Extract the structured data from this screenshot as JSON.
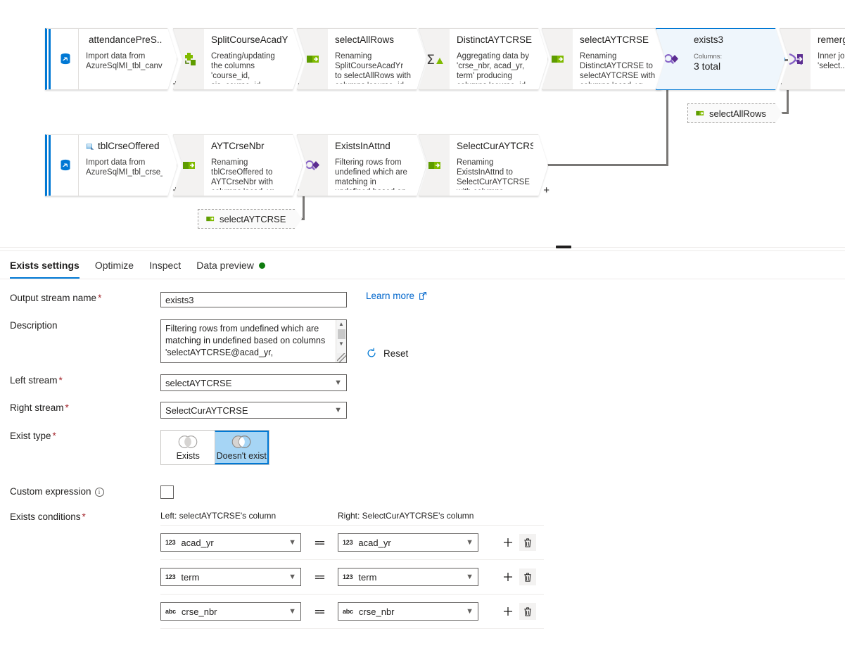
{
  "canvas": {
    "nodes": [
      {
        "id": "attendance-source",
        "kind": "source",
        "title": "attendancePreS...",
        "desc": "Import data from AzureSqlMI_tbl_canvas_attnd_data",
        "icon": "database-source-icon",
        "title_icon": "dataset-icon",
        "plus": "+"
      },
      {
        "id": "split-course-acad-yr",
        "kind": "derived-column",
        "title": "SplitCourseAcadYr",
        "desc": "Creating/updating the columns 'course_id, sis_course_id, course_section_id...",
        "icon": "derived-column-icon",
        "plus": "+"
      },
      {
        "id": "select-all-rows",
        "kind": "select",
        "title": "selectAllRows",
        "desc": "Renaming SplitCourseAcadYr to selectAllRows with columns 'course_id...",
        "icon": "select-icon",
        "plus": "+"
      },
      {
        "id": "distinct-aytcrse",
        "kind": "aggregate",
        "title": "DistinctAYTCRSE",
        "desc": "Aggregating data by 'crse_nbr, acad_yr, term' producing columns 'course_id, sis_course_id...",
        "icon": "aggregate-icon",
        "plus": "+"
      },
      {
        "id": "select-aytcrse",
        "kind": "select",
        "title": "selectAYTCRSE",
        "desc": "Renaming DistinctAYTCRSE to selectAYTCRSE with columns 'acad_yr, term...",
        "icon": "select-icon",
        "plus": "+"
      },
      {
        "id": "exists3",
        "kind": "exists",
        "selected": true,
        "title": "exists3",
        "sub_label": "Columns:",
        "sub_value": "3 total",
        "icon": "exists-icon",
        "plus": "+"
      },
      {
        "id": "remerge",
        "kind": "join",
        "title": "remerge",
        "desc": "Inner join and 'select...",
        "icon": "join-icon"
      },
      {
        "id": "tbl-crse-offered",
        "kind": "source",
        "title": "tblCrseOffered",
        "desc": "Import data from AzureSqlMI_tbl_crse_offered",
        "icon": "database-source-icon",
        "title_icon": "dataset-icon",
        "plus": "+"
      },
      {
        "id": "aytcrsenbr",
        "kind": "select",
        "title": "AYTCrseNbr",
        "desc": "Renaming tblCrseOffered to AYTCrseNbr with columns 'acad_yr, term...",
        "icon": "select-icon",
        "plus": "+"
      },
      {
        "id": "exists-in-attnd",
        "kind": "exists",
        "title": "ExistsInAttnd",
        "desc": "Filtering rows from undefined which are matching in undefined based on columns...",
        "icon": "exists-icon",
        "plus": "+"
      },
      {
        "id": "select-cur-aytcrse",
        "kind": "select",
        "title": "SelectCurAYTCRSE",
        "desc": "Renaming ExistsInAttnd to SelectCurAYTCRSE with columns 'acad_yr, term, crse_nbr'",
        "icon": "select-icon",
        "plus": "+"
      }
    ],
    "reference_pills": [
      {
        "id": "ref-select-all-rows",
        "label": "selectAllRows",
        "icon": "select-icon"
      },
      {
        "id": "ref-select-aytcrse",
        "label": "selectAYTCRSE",
        "icon": "select-icon"
      }
    ]
  },
  "tabs": [
    {
      "id": "exists-settings",
      "label": "Exists settings",
      "active": true
    },
    {
      "id": "optimize",
      "label": "Optimize",
      "active": false
    },
    {
      "id": "inspect",
      "label": "Inspect",
      "active": false
    },
    {
      "id": "data-preview",
      "label": "Data preview",
      "active": false,
      "status_dot": "#107c10"
    }
  ],
  "form": {
    "output_stream_name": {
      "label": "Output stream name",
      "required": "*",
      "value": "exists3"
    },
    "description": {
      "label": "Description",
      "value": "Filtering rows from undefined which are matching in undefined based on columns 'selectAYTCRSE@acad_yr,"
    },
    "left_stream": {
      "label": "Left stream",
      "required": "*",
      "value": "selectAYTCRSE"
    },
    "right_stream": {
      "label": "Right stream",
      "required": "*",
      "value": "SelectCurAYTCRSE"
    },
    "exist_type": {
      "label": "Exist type",
      "required": "*",
      "options": [
        {
          "id": "exists",
          "label": "Exists",
          "selected": false
        },
        {
          "id": "doesnt-exist",
          "label": "Doesn't exist",
          "selected": true
        }
      ]
    },
    "custom_expression": {
      "label": "Custom expression",
      "checked": false
    },
    "exists_conditions": {
      "label": "Exists conditions",
      "required": "*",
      "left_header": "Left: selectAYTCRSE's column",
      "right_header": "Right: SelectCurAYTCRSE's column",
      "operator": "==",
      "rows": [
        {
          "left_type": "123",
          "left_value": "acad_yr",
          "right_type": "123",
          "right_value": "acad_yr"
        },
        {
          "left_type": "123",
          "left_value": "term",
          "right_type": "123",
          "right_value": "term"
        },
        {
          "left_type": "abc",
          "left_value": "crse_nbr",
          "right_type": "abc",
          "right_value": "crse_nbr"
        }
      ]
    },
    "learn_more": {
      "label": "Learn more",
      "icon": "external-link-icon"
    },
    "reset": {
      "label": "Reset",
      "icon": "refresh-icon"
    }
  },
  "colors": {
    "accent": "#0078d4",
    "link": "#0066cc",
    "required": "#a4262c",
    "status_green": "#107c10",
    "selected_fill": "#eff6fc",
    "toggle_selected": "#a6d5f5"
  }
}
